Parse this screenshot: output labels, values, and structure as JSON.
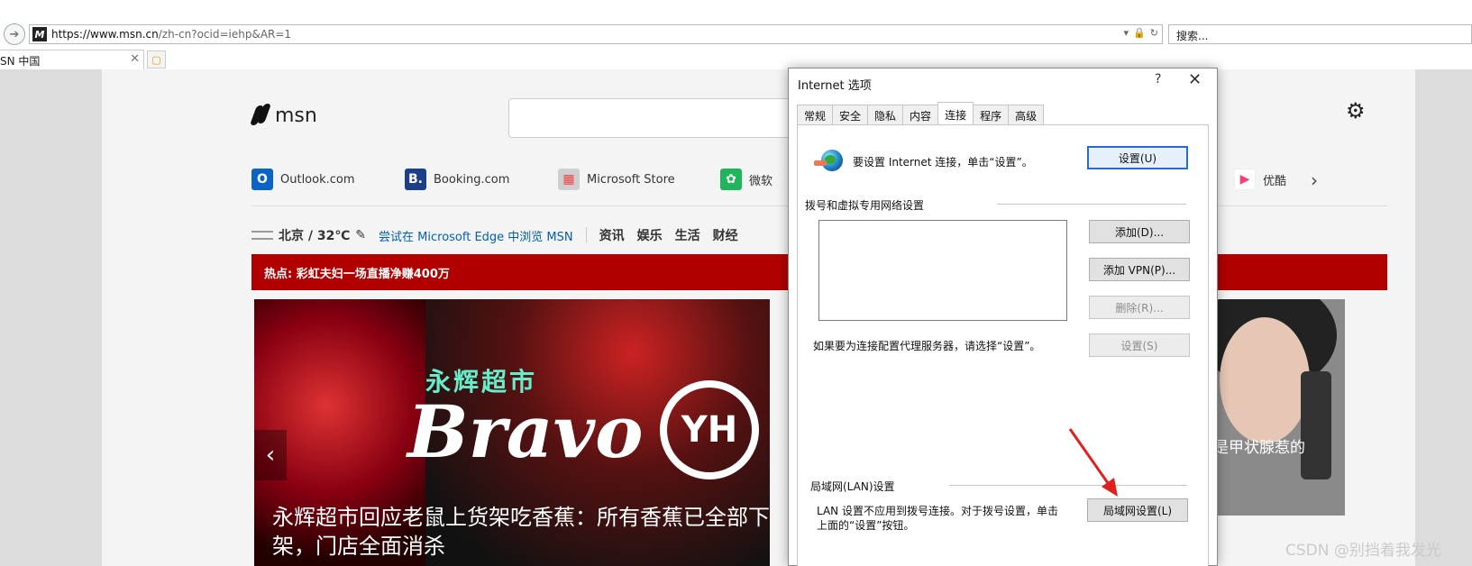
{
  "browser": {
    "url_domain": "https://www.msn.cn",
    "url_rest": "/zh-cn?ocid=iehp&AR=1",
    "search_placeholder": "搜索...",
    "tab_title": "SN 中国"
  },
  "msn": {
    "logo_text": "msn",
    "quicklinks": [
      {
        "label": "Outlook.com",
        "icon": "outlook-icon",
        "color": "#0a64c8"
      },
      {
        "label": "Booking.com",
        "icon": "booking-icon",
        "color": "#1d3f8a"
      },
      {
        "label": "Microsoft Store",
        "icon": "store-icon",
        "color": "#aaaaaa"
      },
      {
        "label": "微软",
        "icon": "microsoft-icon",
        "color": "#1fb55a"
      },
      {
        "label": "优酷",
        "icon": "youku-icon",
        "color": "#ff3a7a"
      }
    ],
    "weather": "北京 / 32℃",
    "edge_link": "尝试在 Microsoft Edge 中浏览 MSN",
    "nav": [
      "资讯",
      "娱乐",
      "生活",
      "财经"
    ],
    "hot": "热点: 彩虹夫妇一场直播净赚400万",
    "hero": {
      "sign": "永辉超市",
      "brand": "Bravo",
      "badge": "YH",
      "caption": "永辉超市回应老鼠上货架吃香蕉：所有香蕉已全部下架，门店全面消杀"
    },
    "side_caption": "题，竟是甲状腺惹的"
  },
  "dialog": {
    "title": "Internet 选项",
    "help": "?",
    "close": "✕",
    "tabs": [
      "常规",
      "安全",
      "隐私",
      "内容",
      "连接",
      "程序",
      "高级"
    ],
    "active_tab": "连接",
    "setup_text": "要设置 Internet 连接，单击“设置”。",
    "setup_button": "设置(U)",
    "dialup_group": "拨号和虚拟专用网络设置",
    "add_button": "添加(D)...",
    "add_vpn_button": "添加 VPN(P)...",
    "remove_button": "删除(R)...",
    "settings_button": "设置(S)",
    "proxy_text": "如果要为连接配置代理服务器，请选择“设置”。",
    "lan_group": "局域网(LAN)设置",
    "lan_text_1": "LAN 设置不应用到拨号连接。对于拨号设置，单击",
    "lan_text_2": "上面的“设置”按钮。",
    "lan_button": "局域网设置(L)"
  },
  "watermark": "CSDN @别挡着我发光",
  "colors": {
    "accent": "#2a6bd1",
    "hotbar": "#b00000",
    "arrow": "#e02020"
  }
}
